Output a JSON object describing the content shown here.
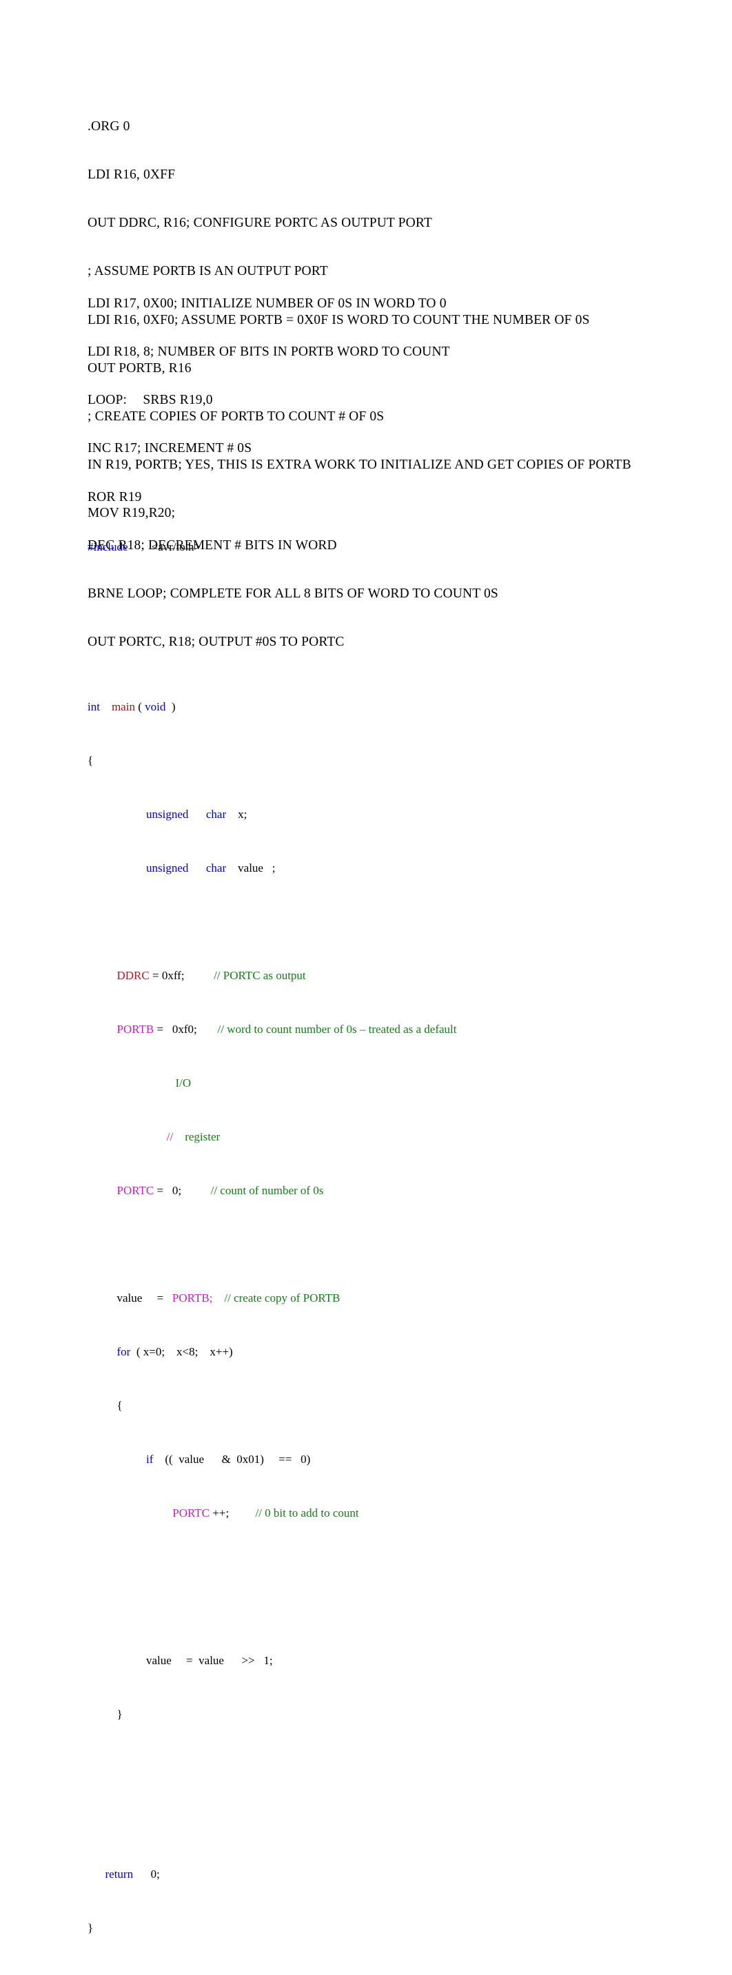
{
  "document": {
    "type": "code-listing",
    "page_background": "#ffffff",
    "colors": {
      "keyword": "#0000cd",
      "function": "#8b1a1a",
      "register_red": "#a0252a",
      "register_purple": "#b429b4",
      "comment": "#1a7a1a",
      "plain": "#000000"
    }
  },
  "assembly_block_1": {
    "lines": [
      ".ORG 0",
      "LDI R16, 0XFF",
      "OUT DDRC, R16; CONFIGURE PORTC AS OUTPUT PORT",
      "; ASSUME PORTB IS AN OUTPUT PORT",
      "LDI R16, 0XF0; ASSUME PORTB = 0X0F IS WORD TO COUNT THE NUMBER OF 0S",
      "OUT PORTB, R16",
      "; CREATE COPIES OF PORTB TO COUNT # OF 0S",
      "IN R19, PORTB; YES, THIS IS EXTRA WORK TO INITIALIZE AND GET COPIES OF PORTB",
      "MOV R19,R20;"
    ]
  },
  "assembly_block_2": {
    "lines": [
      "LDI R17, 0X00; INITIALIZE NUMBER OF 0S IN WORD TO 0",
      "LDI R18, 8; NUMBER OF BITS IN PORTB WORD TO COUNT",
      "LOOP:\tSRBS R19,0",
      "INC R17; INCREMENT # 0S",
      "ROR R19",
      "DEC R18; DECREMENT # BITS IN WORD",
      "BRNE LOOP; COMPLETE FOR ALL 8 BITS OF WORD TO COUNT 0S",
      "OUT PORTC, R18; OUTPUT #0S TO PORTC"
    ]
  },
  "c_code": {
    "include_directive": "#include",
    "include_header": "        <avr/io.h>",
    "signature_int": "int",
    "signature_main": "main",
    "signature_paren_open": " ( ",
    "signature_void": "void",
    "signature_paren_close": "  )",
    "brace_open_main": "{",
    "decl_x_unsigned": "unsigned",
    "decl_x_char": "char",
    "decl_x_name": "    x;",
    "decl_value_unsigned": "unsigned",
    "decl_value_char": "char",
    "decl_value_name": "    value   ;",
    "ddrc_name": "DDRC",
    "ddrc_assign": " = 0xff;",
    "ddrc_comment": "// PORTC as output",
    "portb_name": "PORTB",
    "portb_assign": " =   0xf0;",
    "portb_comment": "// word to count number of 0s – treated as a default",
    "portb_comment_wrap1": "I/O",
    "portb_comment_slashes": "//",
    "portb_comment_wrap2": "    register",
    "portc_name": "PORTC",
    "portc_assign": " =   0;",
    "portc_comment": "// count of number of 0s",
    "value_assign_lhs": "value     =   ",
    "value_assign_rhs": "PORTB;",
    "value_assign_comment": "// create copy of PORTB",
    "for_keyword": "for",
    "for_clause": "  ( x=0;    x<8;    x++)",
    "brace_open_for": "{",
    "if_keyword": "if",
    "if_condition": "    ((  value      &  0x01)     ==   0)",
    "portc_inc_name": "PORTC",
    "portc_inc_op": " ++;",
    "portc_inc_comment": "// 0 bit to add to count",
    "shift_statement": "value     =  value      >>   1;",
    "brace_close_for": "}",
    "return_keyword": "return",
    "return_value": "      0;",
    "brace_close_main": "}"
  }
}
